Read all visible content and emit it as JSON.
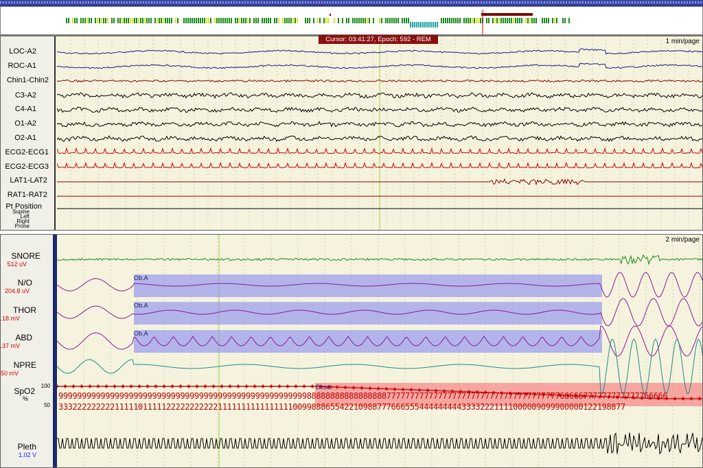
{
  "cursor_label": "Cursor: 03:41:27, Epoch: 592 - REM",
  "top_panel": {
    "scale": "1 min/page",
    "channels": [
      {
        "name": "LOC-A2",
        "color": "#1a1a8a"
      },
      {
        "name": "ROC-A1",
        "color": "#1a1a8a"
      },
      {
        "name": "Chin1-Chin2",
        "color": "#8a0000"
      },
      {
        "name": "C3-A2",
        "color": "#000000"
      },
      {
        "name": "C4-A1",
        "color": "#000000"
      },
      {
        "name": "O1-A2",
        "color": "#000000"
      },
      {
        "name": "O2-A1",
        "color": "#000000"
      },
      {
        "name": "ECG2-ECG1",
        "color": "#cc0000"
      },
      {
        "name": "ECG2-ECG3",
        "color": "#cc0000"
      },
      {
        "name": "LAT1-LAT2",
        "color": "#8a0000"
      },
      {
        "name": "RAT1-RAT2",
        "color": "#8a0000"
      }
    ],
    "position": {
      "name": "Pt Position",
      "levels": [
        "Supine",
        "Left",
        "Right",
        "Prone"
      ]
    }
  },
  "bottom_panel": {
    "scale": "2 min/page",
    "channels": [
      {
        "name": "SNORE",
        "unit": "512 uV"
      },
      {
        "name": "N/O",
        "unit": "204.8 uV"
      },
      {
        "name": "THOR",
        "unit": "2.18 mV"
      },
      {
        "name": "ABD",
        "unit": "4.37 mV"
      },
      {
        "name": "NPRE",
        "unit": "50 mV"
      },
      {
        "name": "SpO2",
        "unit": "%"
      },
      {
        "name": "Pleth",
        "unit": "1.02 V"
      }
    ],
    "events": {
      "obstructive_apnea": "Ob.A",
      "desat": "Desat"
    },
    "spo2_axis": {
      "top": "100",
      "mid": "50"
    },
    "spo2_row1": "9999999999999999999999999999999999999999999999999999988888888888888888777777777777777777777777777777777777766666777777777777766666",
    "spo2_row2": "3332222222221111101111122222222222111111111111111100998886554221098877766655544444444433332221111000009099900000122198877"
  },
  "colors": {
    "panel_bg": "#f5f3dd",
    "apnea": "#8f92f0",
    "desat": "#f58c8c",
    "spo2": "#d01010"
  }
}
